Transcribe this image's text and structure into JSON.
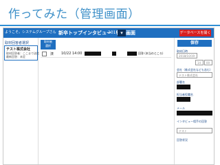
{
  "slide": {
    "title": "作ってみた（管理画面）"
  },
  "topbar": {
    "welcome": "ようこそ。システムグループさん",
    "title": "新卒トップインタビュー　管理画面",
    "year_label": "2018",
    "year_value": "",
    "db_button": "データベースを開く"
  },
  "leftpane": {
    "header": "取材回答者選択",
    "selected_name": "テスト株式会社",
    "line1": "取材回答者：ここまで送信",
    "line2": "最新回答：未定"
  },
  "midpane": {
    "filter_label": "取材者\n選択",
    "row": {
      "col1": "済",
      "col2": "10/22 14:00",
      "col3": "回答 (本当のところ)",
      "col4": "回答"
    }
  },
  "rightpane": {
    "save_label": "保存",
    "date_label": "取材日時",
    "date_value": "2018/10/19",
    "hour_value": "14",
    "minute_value": "00",
    "company_label": "会社（株式会社なども含む）",
    "company_value": "テスト株式会社",
    "dept_label": "部署名",
    "contact_label": "担当者役職名",
    "email_label": "メール",
    "note_label": "インタビュー相手の回答",
    "note_value": "テスト",
    "status_label": "回答状況"
  }
}
